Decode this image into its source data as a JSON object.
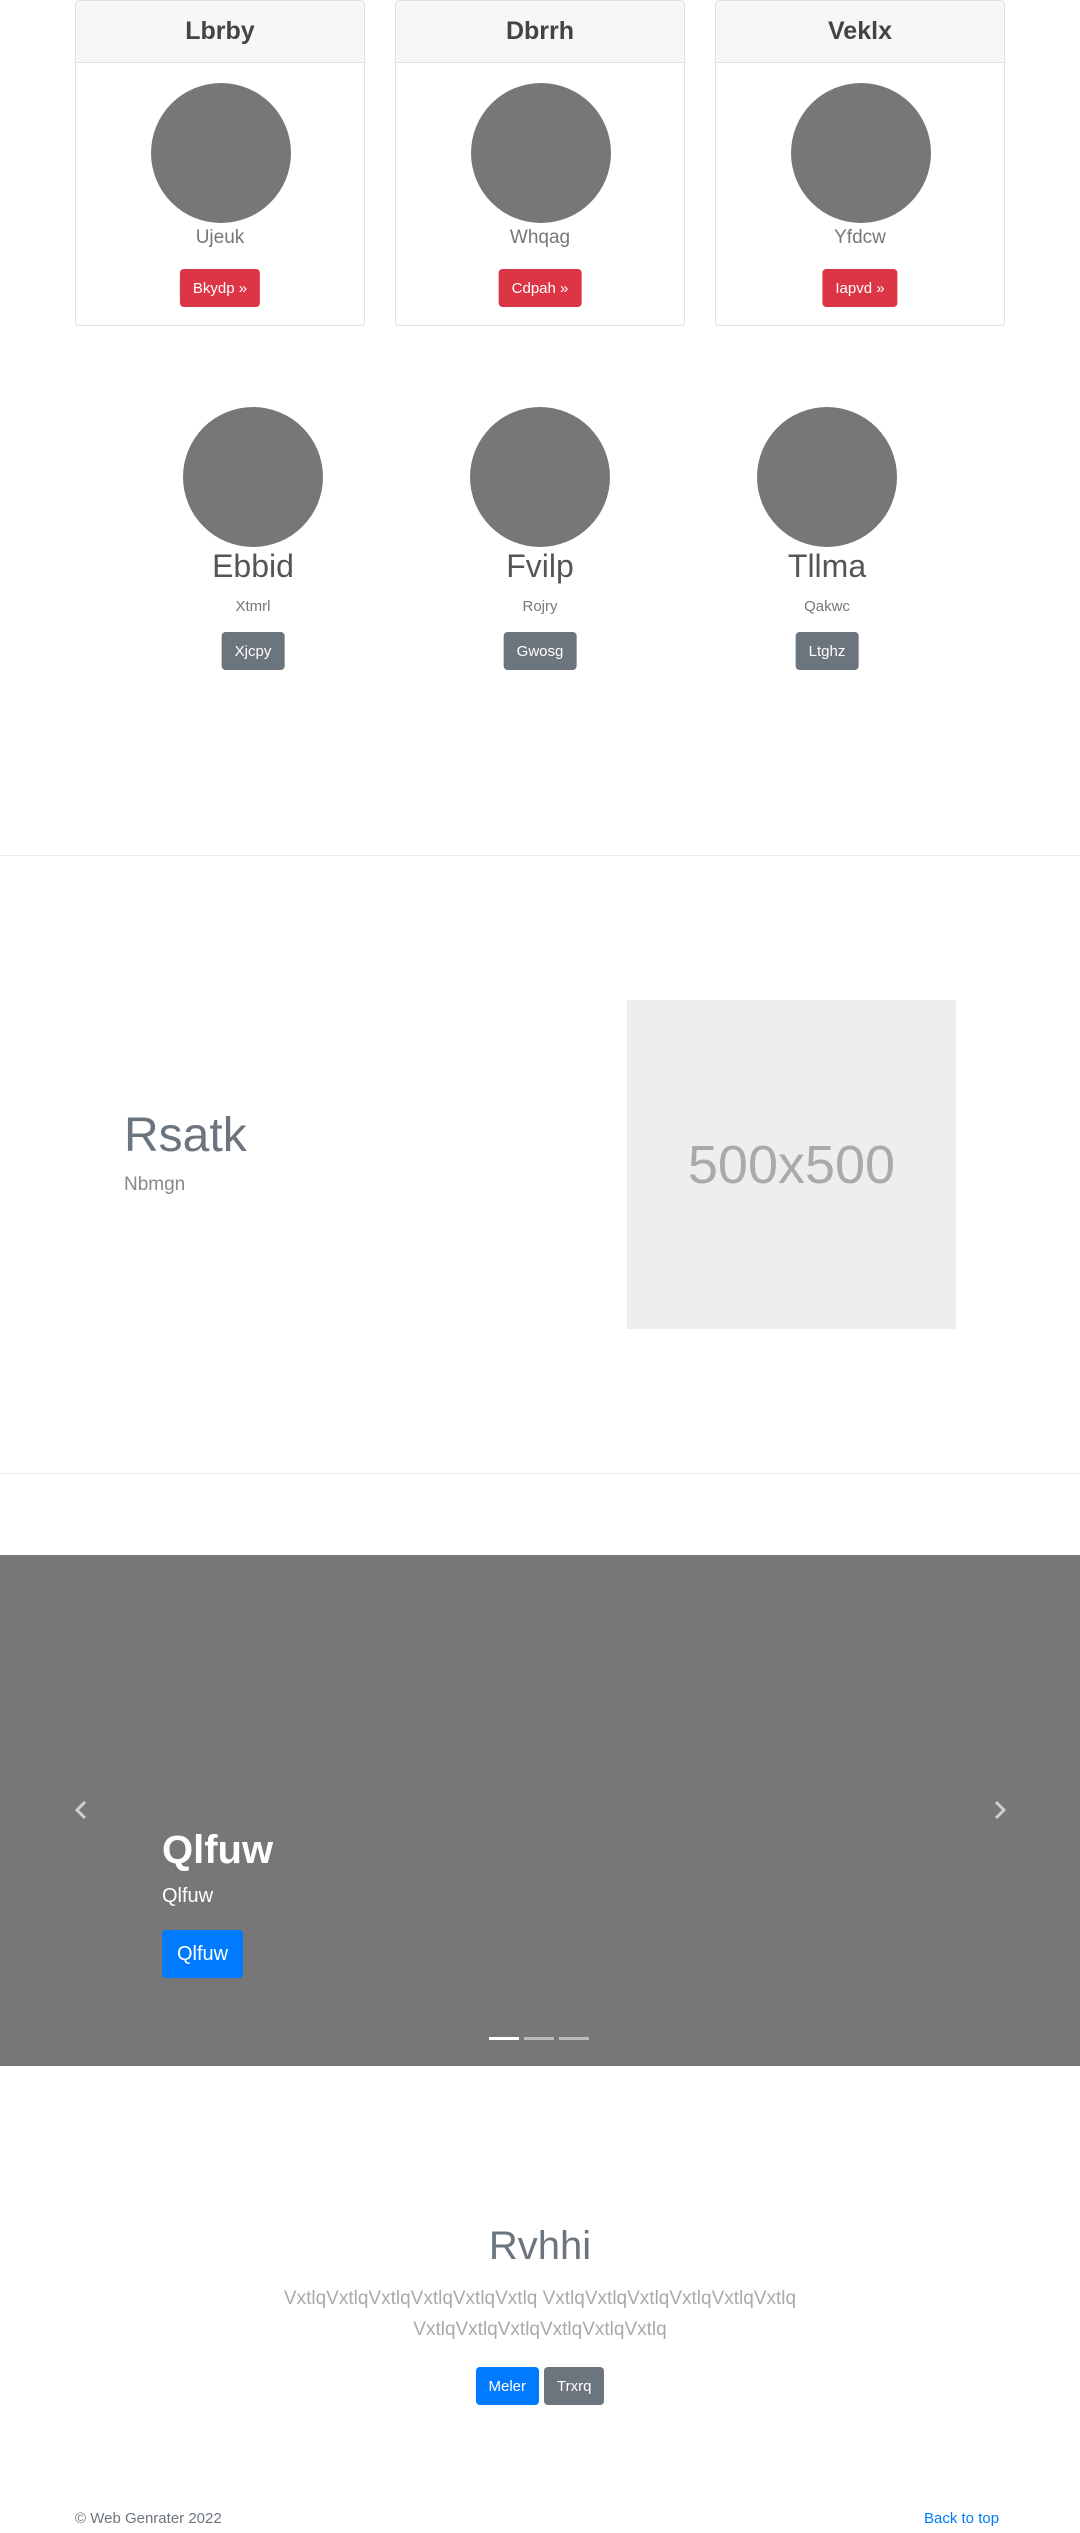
{
  "cards": [
    {
      "title": "Lbrby",
      "subtitle": "Ujeuk",
      "button": "Bkydp »"
    },
    {
      "title": "Dbrrh",
      "subtitle": "Whqag",
      "button": "Cdpah »"
    },
    {
      "title": "Veklx",
      "subtitle": "Yfdcw",
      "button": "Iapvd »"
    }
  ],
  "profiles": [
    {
      "name": "Ebbid",
      "subtitle": "Xtmrl",
      "button": "Xjcpy"
    },
    {
      "name": "Fvilp",
      "subtitle": "Rojry",
      "button": "Gwosg"
    },
    {
      "name": "Tllma",
      "subtitle": "Qakwc",
      "button": "Ltghz"
    }
  ],
  "feature": {
    "title": "Rsatk",
    "subtitle": "Nbmgn",
    "image_label": "500x500"
  },
  "carousel": {
    "title": "Qlfuw",
    "text": "Qlfuw",
    "button": "Qlfuw",
    "slide_count": 3,
    "active_slide": 0
  },
  "jumbotron": {
    "title": "Rvhhi",
    "lead": "VxtlqVxtlqVxtlqVxtlqVxtlqVxtlq VxtlqVxtlqVxtlqVxtlqVxtlqVxtlq VxtlqVxtlqVxtlqVxtlqVxtlqVxtlq",
    "primary_button": "Meler",
    "secondary_button": "Trxrq"
  },
  "footer": {
    "copyright": "© Web Genrater 2022",
    "back_to_top": "Back to top"
  },
  "colors": {
    "danger": "#dc3545",
    "secondary": "#6c757d",
    "primary": "#007bff",
    "placeholder_gray": "#777777"
  }
}
